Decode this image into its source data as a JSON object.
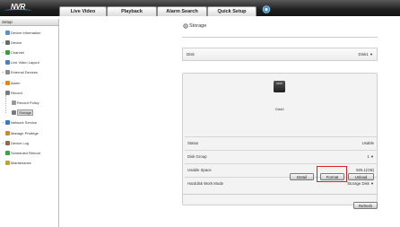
{
  "brand": {
    "logo": "NVR"
  },
  "tabs": [
    "Live Video",
    "Playback",
    "Alarm Search",
    "Quick Setup"
  ],
  "sidebar": {
    "header": "Setup",
    "items": [
      {
        "label": "Device Information",
        "level": 0,
        "expander": "",
        "icon": "device-info-icon",
        "color": "#5b8fc7"
      },
      {
        "label": "Device",
        "level": 0,
        "expander": "+",
        "icon": "device-icon",
        "color": "#6a6a6a"
      },
      {
        "label": "Channel",
        "level": 0,
        "expander": "+",
        "icon": "channel-icon",
        "color": "#3c9a3c"
      },
      {
        "label": "Live Video Layout",
        "level": 0,
        "expander": "",
        "icon": "layout-icon",
        "color": "#4f7fb8"
      },
      {
        "label": "External Devices",
        "level": 0,
        "expander": "+",
        "icon": "external-devices-icon",
        "color": "#8a8a8a"
      },
      {
        "label": "Alarm",
        "level": 0,
        "expander": "+",
        "icon": "alarm-icon",
        "color": "#d98c1c"
      },
      {
        "label": "Record",
        "level": 0,
        "expander": "-",
        "icon": "record-icon",
        "color": "#7a7a7a"
      },
      {
        "label": "Record Policy",
        "level": 1,
        "expander": "",
        "icon": "record-policy-icon",
        "color": "#9a9a9a"
      },
      {
        "label": "Storage",
        "level": 1,
        "expander": "",
        "icon": "storage-icon",
        "color": "#7a7a7a",
        "selected": true
      },
      {
        "label": "Network Service",
        "level": 0,
        "expander": "+",
        "icon": "network-service-icon",
        "color": "#3a7ac0"
      },
      {
        "label": "Manage Privilege",
        "level": 0,
        "expander": "",
        "icon": "privilege-icon",
        "color": "#c08a40"
      },
      {
        "label": "Device Log",
        "level": 0,
        "expander": "+",
        "icon": "device-log-icon",
        "color": "#8a6a4a"
      },
      {
        "label": "Scheduled Reboot",
        "level": 0,
        "expander": "",
        "icon": "reboot-icon",
        "color": "#3aa04a"
      },
      {
        "label": "Maintenance",
        "level": 0,
        "expander": "",
        "icon": "maintenance-icon",
        "color": "#c0a040"
      }
    ]
  },
  "main": {
    "title": "Storage",
    "disk_select": {
      "label": "Disk",
      "value": "Disk1"
    },
    "hdd": {
      "badge": "HDD",
      "name": "Disk1"
    },
    "props": [
      {
        "key": "Status",
        "value": "Usable",
        "dropdown": false
      },
      {
        "key": "Disk Group",
        "value": "1",
        "dropdown": true
      },
      {
        "key": "Usable Space",
        "value": "925.1(GB)",
        "dropdown": false
      },
      {
        "key": "Harddisk Work Mode",
        "value": "Storage Disk",
        "dropdown": true
      }
    ],
    "buttons": {
      "detail": "Detail",
      "format": "Format",
      "unload": "Unload",
      "refresh": "Refresh"
    }
  },
  "colors": {
    "accent_highlight": "#e02020",
    "topbar": "#1e1e1e"
  }
}
